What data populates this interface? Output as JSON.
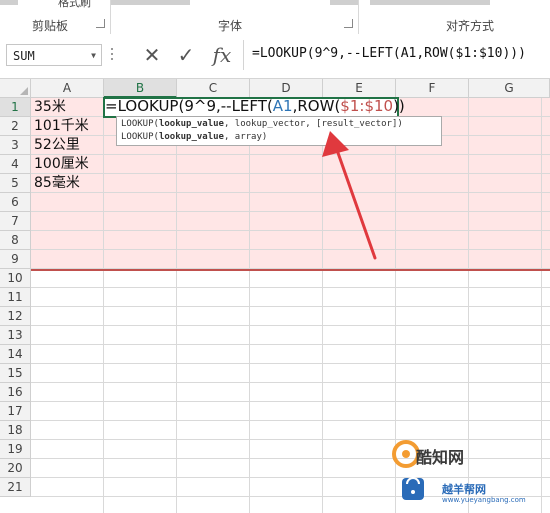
{
  "ribbon": {
    "clipboard_item": "格式刷",
    "groups": [
      "剪贴板",
      "字体",
      "对齐方式"
    ]
  },
  "formula_bar": {
    "name_box": "SUM",
    "cancel_icon": "✕",
    "enter_icon": "✓",
    "function_icon": "fx",
    "content": "=LOOKUP(9^9,--LEFT(A1,ROW($1:$10)))"
  },
  "columns": [
    "A",
    "B",
    "C",
    "D",
    "E",
    "F",
    "G"
  ],
  "rows": [
    "1",
    "2",
    "3",
    "4",
    "5",
    "6",
    "7",
    "8",
    "9",
    "10",
    "11",
    "12",
    "13",
    "14",
    "15",
    "16",
    "17",
    "18",
    "19",
    "20",
    "21"
  ],
  "cells": {
    "a1": "35米",
    "a2": "101千米",
    "a3": "52公里",
    "a4": "100厘米",
    "a5": "85毫米"
  },
  "active_cell": {
    "fn": "=LOOKUP(",
    "arg1": "9^9,--LEFT(",
    "ref1": "A1",
    "mid": ",ROW(",
    "ref2": "$1:$10",
    "close": "))"
  },
  "tooltip": {
    "line1_fn": "LOOKUP(",
    "line1_bold": "lookup_value",
    "line1_rest": ", lookup_vector, [result_vector])",
    "line2_fn": "LOOKUP(",
    "line2_bold": "lookup_value",
    "line2_rest": ", array)"
  },
  "watermark": {
    "title": "酷知网",
    "subtitle": "越羊帮网",
    "url": "www.yueyangbang.com"
  },
  "colors": {
    "accent": "#217346",
    "highlight_fill": "#ffd2d2",
    "arrow": "#e0393e"
  }
}
